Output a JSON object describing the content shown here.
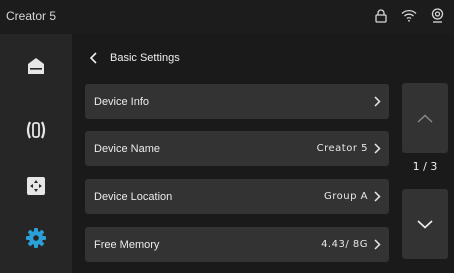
{
  "app": {
    "title": "Creator 5"
  },
  "status_icons": [
    "lock-icon",
    "wifi-icon",
    "webcam-icon"
  ],
  "sidebar": {
    "items": [
      {
        "name": "home",
        "icon": "home-icon",
        "active": false
      },
      {
        "name": "filament",
        "icon": "filament-spool-icon",
        "active": false
      },
      {
        "name": "move",
        "icon": "move-axis-icon",
        "active": false
      },
      {
        "name": "settings",
        "icon": "gear-icon",
        "active": true
      }
    ]
  },
  "header": {
    "title": "Basic Settings"
  },
  "rows": [
    {
      "label": "Device Info",
      "value": ""
    },
    {
      "label": "Device Name",
      "value": "Creator 5"
    },
    {
      "label": "Device Location",
      "value": "Group A"
    },
    {
      "label": "Free Memory",
      "value": "4.43/ 8G"
    }
  ],
  "pagination": {
    "indicator": "1 / 3"
  },
  "colors": {
    "accent": "#2a9fd8",
    "panel": "#333333",
    "sidebar": "#262626",
    "background": "#1a1a1a"
  }
}
